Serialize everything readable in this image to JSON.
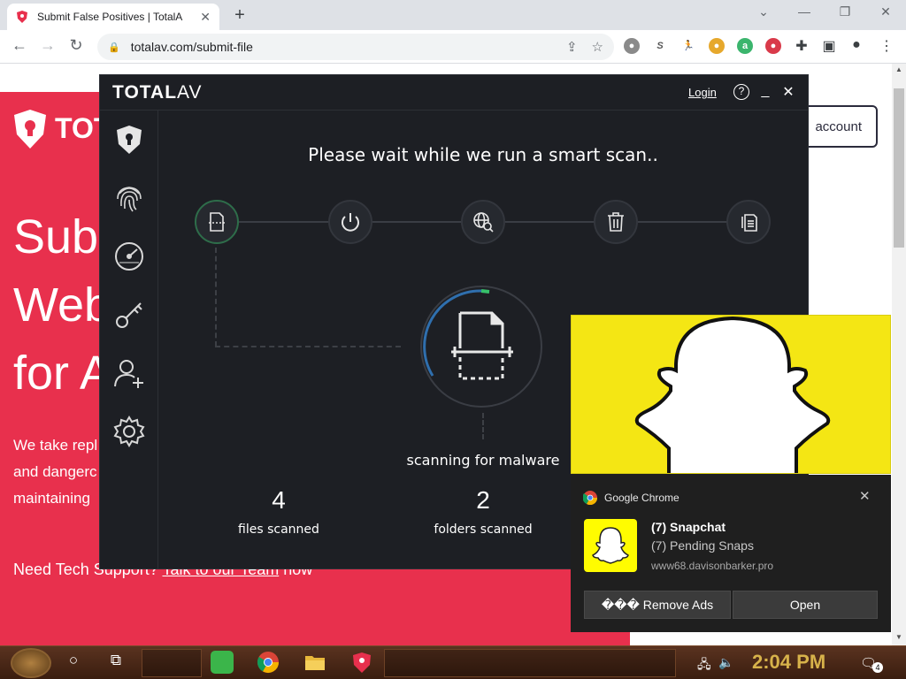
{
  "browser": {
    "tab_title": "Submit False Positives | TotalA",
    "url": "totalav.com/submit-file"
  },
  "page": {
    "logo_text": "TOT",
    "hero_lines": [
      "Subm",
      "Web",
      "for A"
    ],
    "para_lines": [
      "We take repl",
      "and dangerc",
      "maintaining"
    ],
    "support_prefix": "Need Tech Support?",
    "support_link": "Talk to our Team",
    "support_suffix": "now",
    "account_button": "account",
    "brand_color": "#e8304d"
  },
  "totalav": {
    "brand_bold": "TOTAL",
    "brand_light": "AV",
    "login_label": "Login",
    "help_label": "?",
    "heading": "Please wait while we run a smart scan..",
    "scan_status": "scanning for malware",
    "files_count": "4",
    "files_label": "files scanned",
    "folders_count": "2",
    "folders_label": "folders scanned",
    "sidebar_icons": [
      "shield-icon",
      "fingerprint-icon",
      "speedometer-icon",
      "key-icon",
      "add-user-icon",
      "settings-icon"
    ],
    "step_icons": [
      "file-scan-icon",
      "power-icon",
      "web-search-icon",
      "trash-icon",
      "documents-icon"
    ]
  },
  "notification": {
    "source": "Google Chrome",
    "title": "(7) Snapchat",
    "body": "(7) Pending Snaps",
    "site": "www68.davisonbarker.pro",
    "remove_ads": "��� Remove Ads",
    "open": "Open"
  },
  "taskbar": {
    "time": "2:04 PM",
    "notif_count": "4"
  }
}
